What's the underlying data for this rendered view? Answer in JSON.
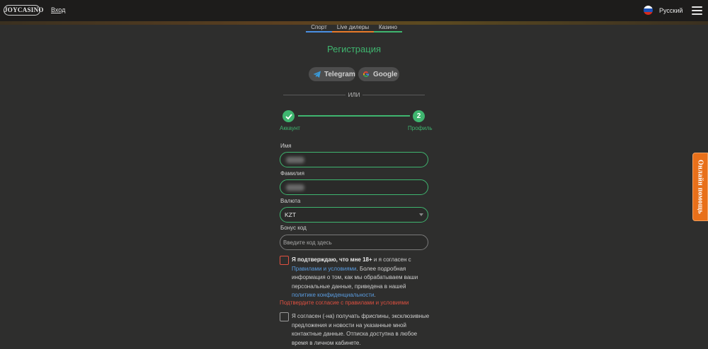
{
  "header": {
    "logo_text": "JOYCASINO",
    "login_label": "Вход",
    "language_label": "Русский"
  },
  "nav_tabs": [
    {
      "label": "Спорт",
      "color": "#4a90e2"
    },
    {
      "label": "Live дилеры",
      "color": "#e87a2a"
    },
    {
      "label": "Казино",
      "color": "#3fb56f"
    }
  ],
  "form": {
    "title": "Регистрация",
    "social": {
      "telegram_label": "Telegram",
      "google_label": "Google"
    },
    "divider_text": "ИЛИ",
    "steps": {
      "step1_label": "Аккаунт",
      "step2_number": "2",
      "step2_label": "Профиль"
    },
    "first_name_label": "Имя",
    "last_name_label": "Фамилия",
    "currency_label": "Валюта",
    "currency_value": "KZT",
    "bonus_label": "Бонус код",
    "bonus_placeholder": "Введите код здесь",
    "terms": {
      "bold": "Я подтверждаю, что мне 18+",
      "text1": " и я согласен с ",
      "link1": "Правилами и условиями",
      "text2": ". Более подробная информация о том, как мы обрабатываем ваши персональные данные, приведена в нашей ",
      "link2": "политике конфиденциальности",
      "text3": "."
    },
    "terms_error": "Подтвердите согласие с правилами и условиями",
    "marketing_text": "Я согласен (-на) получать фриспины, эксклюзивные предложения и новости на указанные мной контактные данные. Отписка доступна в любое время в личном кабинете."
  },
  "help_tab_label": "Онлайн помощь",
  "colors": {
    "accent_green": "#3fb56f",
    "error_red": "#e05040",
    "link_blue": "#5a9ce0",
    "help_orange": "#e8701a"
  }
}
